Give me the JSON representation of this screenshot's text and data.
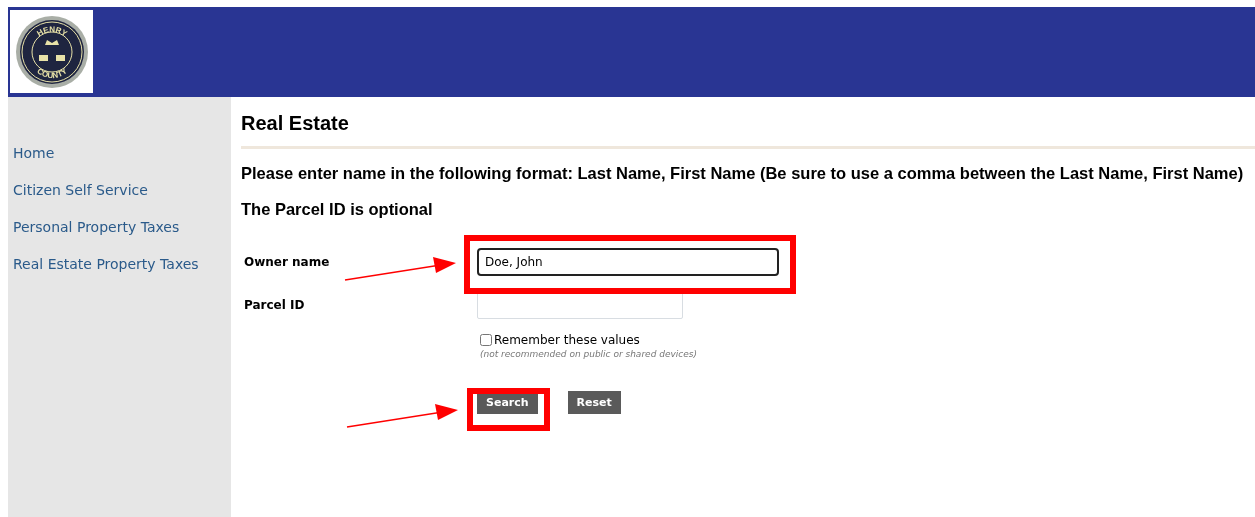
{
  "logo": {
    "top_text": "HENRY",
    "bottom_text": "COUNTY"
  },
  "sidebar": {
    "items": [
      {
        "label": "Home"
      },
      {
        "label": "Citizen Self Service"
      },
      {
        "label": "Personal Property Taxes"
      },
      {
        "label": "Real Estate Property Taxes"
      }
    ]
  },
  "page_title": "Real Estate",
  "instructions": [
    "Please enter name in the following format: Last Name, First Name (Be sure to use a comma between the Last Name, First Name)",
    "The Parcel ID is optional"
  ],
  "form": {
    "fields": [
      {
        "label": "Owner name",
        "value": "Doe, John",
        "focused": true
      },
      {
        "label": "Parcel ID",
        "focused": false
      }
    ],
    "remember": {
      "label": "Remember these values",
      "note": "(not recommended on public or shared devices)",
      "checked": false
    },
    "buttons": [
      "Search",
      "Reset"
    ]
  }
}
